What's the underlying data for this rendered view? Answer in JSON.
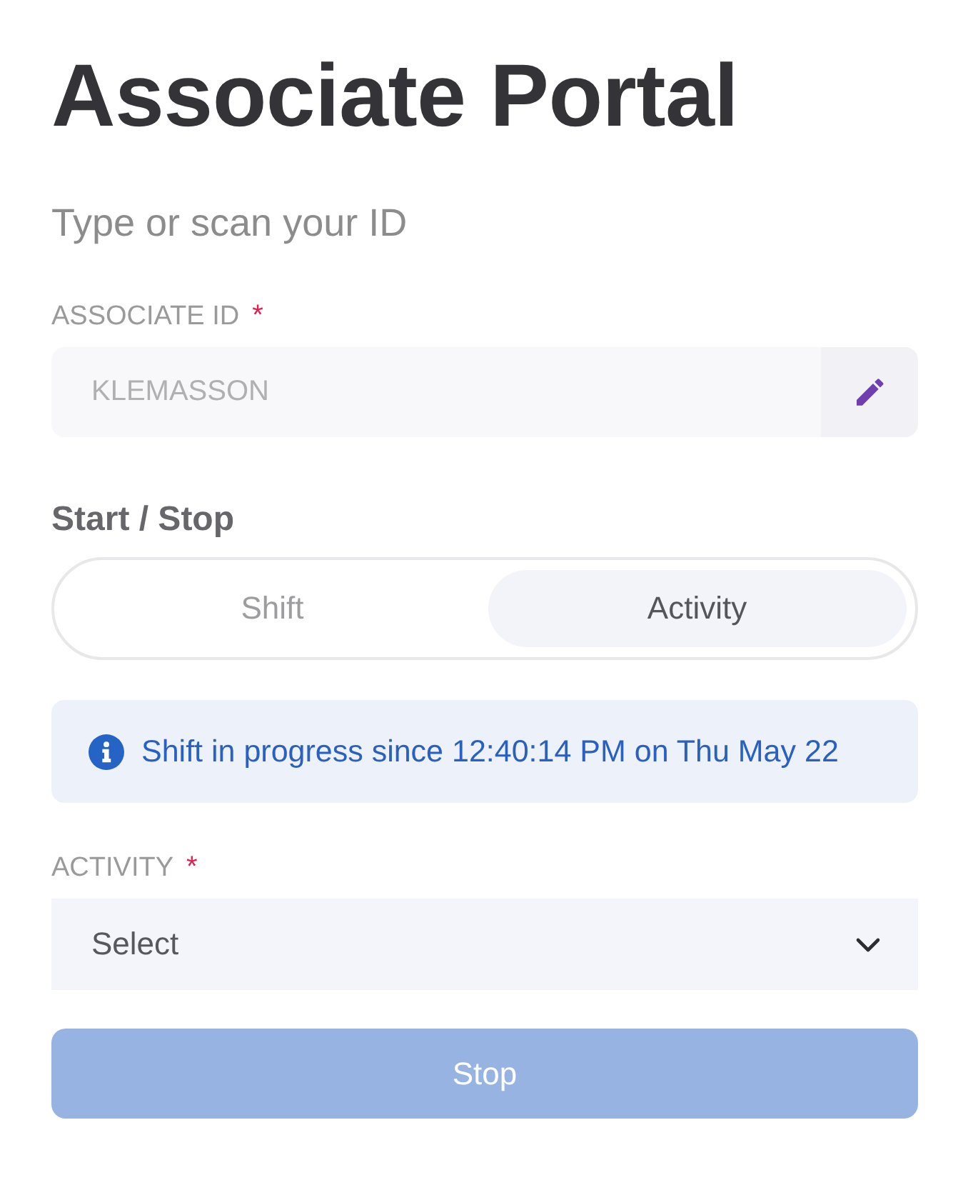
{
  "title": "Associate Portal",
  "subtitle": "Type or scan your ID",
  "associate_id": {
    "label": "ASSOCIATE ID",
    "required_mark": "*",
    "value": "KLEMASSON",
    "disabled": true
  },
  "start_stop": {
    "label": "Start / Stop",
    "segments": [
      {
        "label": "Shift",
        "selected": false
      },
      {
        "label": "Activity",
        "selected": true
      }
    ]
  },
  "info_banner": {
    "text": "Shift in progress since 12:40:14 PM on Thu May 22"
  },
  "activity": {
    "label": "ACTIVITY",
    "required_mark": "*",
    "placeholder": "Select"
  },
  "primary_button": {
    "label": "Stop",
    "disabled": true
  }
}
